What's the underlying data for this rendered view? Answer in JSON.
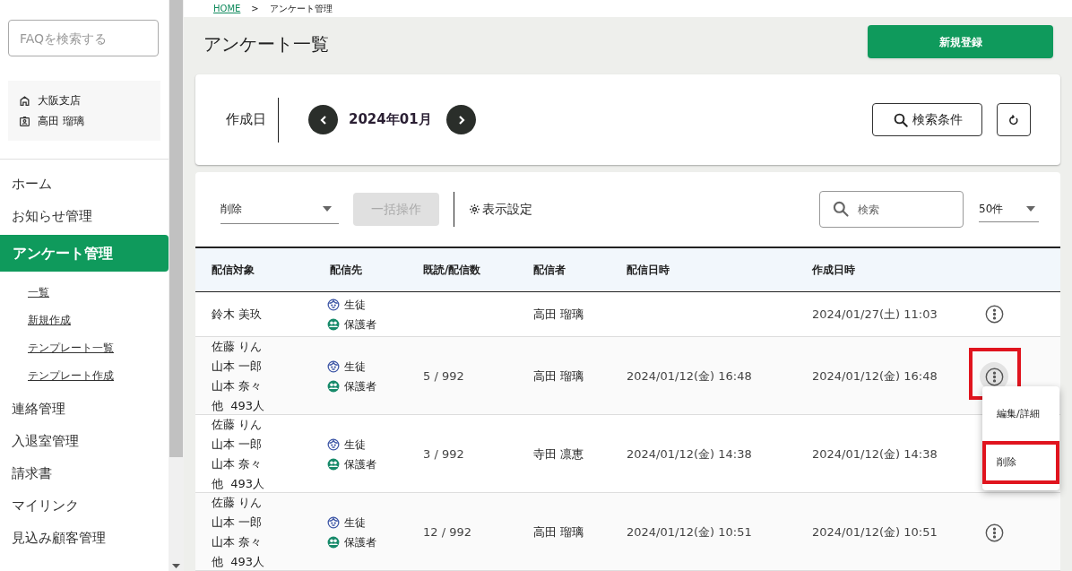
{
  "sidebar": {
    "faq_search": {
      "placeholder": "FAQを検索する"
    },
    "account": [
      {
        "kind": "branch",
        "label": "大阪支店"
      },
      {
        "kind": "user",
        "label": "高田 瑠璃"
      }
    ],
    "nav": [
      {
        "label": "ホーム",
        "selected": false
      },
      {
        "label": "お知らせ管理",
        "selected": false
      },
      {
        "label": "アンケート管理",
        "selected": true,
        "children": [
          {
            "label": "一覧"
          },
          {
            "label": "新規作成"
          },
          {
            "label": "テンプレート一覧"
          },
          {
            "label": "テンプレート作成"
          }
        ]
      },
      {
        "label": "連絡管理",
        "selected": false
      },
      {
        "label": "入退室管理",
        "selected": false
      },
      {
        "label": "請求書",
        "selected": false
      },
      {
        "label": "マイリンク",
        "selected": false
      },
      {
        "label": "見込み顧客管理",
        "selected": false
      }
    ]
  },
  "breadcrumb": [
    {
      "label": "HOME",
      "kind": "link"
    },
    {
      "label": ">",
      "kind": "separator"
    },
    {
      "label": "アンケート管理",
      "kind": "current"
    }
  ],
  "page_title": "アンケート一覧",
  "new_button": "新規登録",
  "date_filter": {
    "label": "作成日",
    "value": "2024年01月"
  },
  "search_conditions_button": "検索条件",
  "toolbar": {
    "action_select": "削除",
    "bulk_button": {
      "label": "一括操作",
      "disabled": true
    },
    "display_settings": "表示設定",
    "search": {
      "placeholder": "検索"
    },
    "page_size": "50件"
  },
  "table": {
    "columns": [
      "配信対象",
      "配信先",
      "既読/配信数",
      "配信者",
      "配信日時",
      "作成日時"
    ],
    "rows": [
      {
        "targets": [
          "鈴木 美玖"
        ],
        "recipients": [
          {
            "kind": "student",
            "label": "生徒"
          },
          {
            "kind": "guardian",
            "label": "保護者"
          }
        ],
        "count": "",
        "sender": "高田 瑠璃",
        "delivered_at": "",
        "created_at": "2024/01/27(土) 11:03",
        "menu_active": false,
        "annotated": false
      },
      {
        "targets": [
          "佐藤 りん",
          "山本 一郎",
          "山本 奈々",
          "他  493人"
        ],
        "recipients": [
          {
            "kind": "student",
            "label": "生徒"
          },
          {
            "kind": "guardian",
            "label": "保護者"
          }
        ],
        "count": "5 / 992",
        "sender": "高田 瑠璃",
        "delivered_at": "2024/01/12(金) 16:48",
        "created_at": "2024/01/12(金) 16:48",
        "menu_active": true,
        "annotated": true
      },
      {
        "targets": [
          "佐藤 りん",
          "山本 一郎",
          "山本 奈々",
          "他  493人"
        ],
        "recipients": [
          {
            "kind": "student",
            "label": "生徒"
          },
          {
            "kind": "guardian",
            "label": "保護者"
          }
        ],
        "count": "3 / 992",
        "sender": "寺田 凛恵",
        "delivered_at": "2024/01/12(金) 14:38",
        "created_at": "2024/01/12(金) 14:38",
        "menu_active": false,
        "annotated": false
      },
      {
        "targets": [
          "佐藤 りん",
          "山本 一郎",
          "山本 奈々",
          "他  493人"
        ],
        "recipients": [
          {
            "kind": "student",
            "label": "生徒"
          },
          {
            "kind": "guardian",
            "label": "保護者"
          }
        ],
        "count": "12 / 992",
        "sender": "高田 瑠璃",
        "delivered_at": "2024/01/12(金) 10:51",
        "created_at": "2024/01/12(金) 10:51",
        "menu_active": false,
        "annotated": false
      }
    ]
  },
  "row_menu": {
    "items": [
      {
        "label": "編集/詳細",
        "annotated": false
      },
      {
        "label": "削除",
        "annotated": true
      }
    ]
  }
}
